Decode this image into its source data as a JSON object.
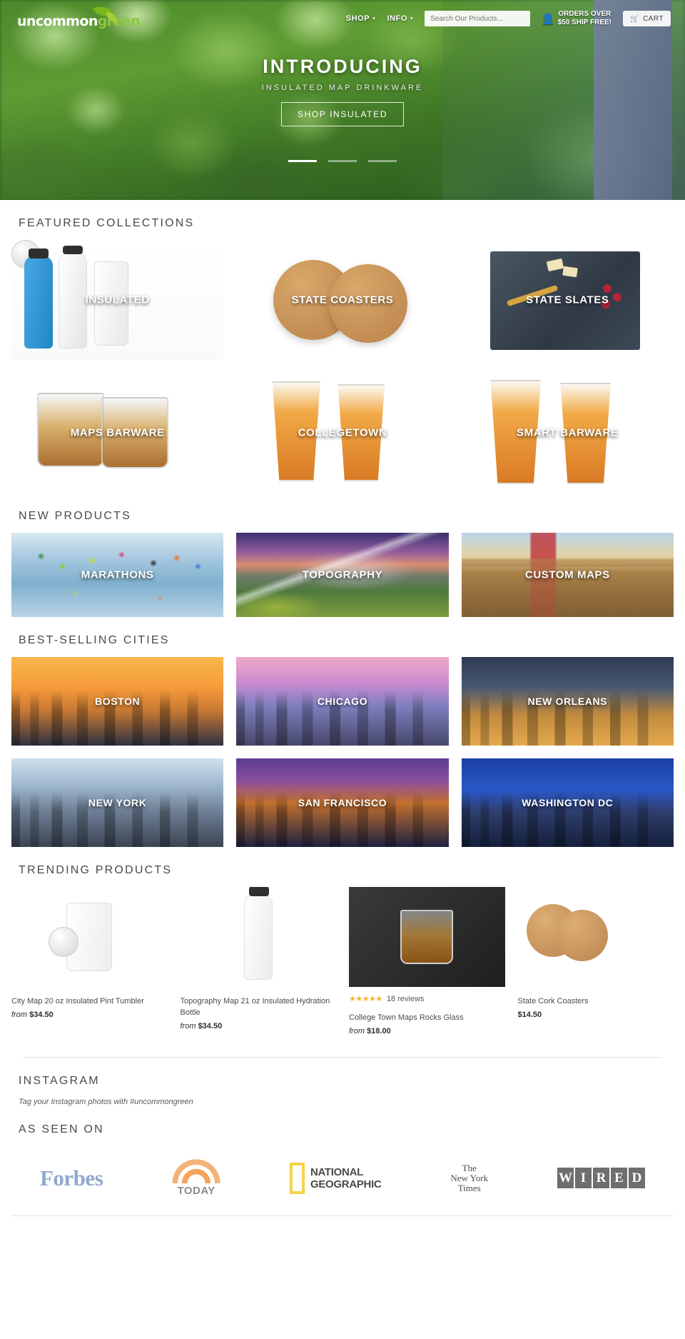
{
  "brand": {
    "name_dark": "uncommon",
    "name_green": "green"
  },
  "header": {
    "nav": [
      {
        "label": "SHOP",
        "caret": "▾"
      },
      {
        "label": "INFO",
        "caret": "▾"
      }
    ],
    "search_placeholder": "Search Our Products...",
    "search_value": "",
    "shipping_line1": "ORDERS OVER",
    "shipping_line2": "$50 SHIP FREE!",
    "cart_label": "CART",
    "account_icon": "person-icon",
    "cart_icon": "shopping-cart-icon"
  },
  "hero": {
    "title": "INTRODUCING",
    "subtitle": "INSULATED MAP DRINKWARE",
    "button": "SHOP INSULATED",
    "slides": 3,
    "active_slide": 1
  },
  "featured": {
    "heading": "FEATURED COLLECTIONS",
    "tiles": [
      {
        "label": "INSULATED",
        "art": "insulated"
      },
      {
        "label": "STATE COASTERS",
        "art": "coasters"
      },
      {
        "label": "STATE SLATES",
        "art": "slate"
      },
      {
        "label": "MAPS BARWARE",
        "art": "barware"
      },
      {
        "label": "COLLEGETOWN",
        "art": "pint"
      },
      {
        "label": "SMART BARWARE",
        "art": "smart"
      }
    ]
  },
  "new_products": {
    "heading": "NEW PRODUCTS",
    "tiles": [
      {
        "label": "MARATHONS",
        "art": "marathon"
      },
      {
        "label": "TOPOGRAPHY",
        "art": "topo"
      },
      {
        "label": "CUSTOM MAPS",
        "art": "custom"
      }
    ]
  },
  "cities": {
    "heading": "BEST-SELLING CITIES",
    "tiles": [
      {
        "label": "BOSTON",
        "art": "boston"
      },
      {
        "label": "CHICAGO",
        "art": "chicago"
      },
      {
        "label": "NEW ORLEANS",
        "art": "nola"
      },
      {
        "label": "NEW YORK",
        "art": "ny"
      },
      {
        "label": "SAN FRANCISCO",
        "art": "sf"
      },
      {
        "label": "WASHINGTON DC",
        "art": "dc"
      }
    ]
  },
  "trending": {
    "heading": "TRENDING PRODUCTS",
    "products": [
      {
        "name": "City Map 20 oz Insulated Pint Tumbler",
        "price_prefix": "from",
        "price": "$34.50",
        "reviews": "",
        "stars": ""
      },
      {
        "name": "Topography Map 21 oz Insulated Hydration Bottle",
        "price_prefix": "from",
        "price": "$34.50",
        "reviews": "",
        "stars": ""
      },
      {
        "name": "College Town Maps Rocks Glass",
        "price_prefix": "from",
        "price": "$18.00",
        "reviews": "18 reviews",
        "stars": "★★★★★"
      },
      {
        "name": "State Cork Coasters",
        "price_prefix": "",
        "price": "$14.50",
        "reviews": "",
        "stars": ""
      }
    ]
  },
  "instagram": {
    "heading": "INSTAGRAM",
    "subtitle": "Tag your Instagram photos with #uncommongreen"
  },
  "press": {
    "heading": "AS SEEN ON",
    "logos": [
      {
        "name": "Forbes"
      },
      {
        "name": "TODAY"
      },
      {
        "name_line1": "NATIONAL",
        "name_line2": "GEOGRAPHIC"
      },
      {
        "name_line1": "The",
        "name_line2": "New York",
        "name_line3": "Times"
      },
      {
        "name": "WIRED",
        "chars": [
          "W",
          "I",
          "R",
          "E",
          "D"
        ]
      }
    ]
  },
  "colors": {
    "accent_green": "#8dc63f",
    "star_gold": "#f5b324",
    "text": "#4a4a4a"
  }
}
